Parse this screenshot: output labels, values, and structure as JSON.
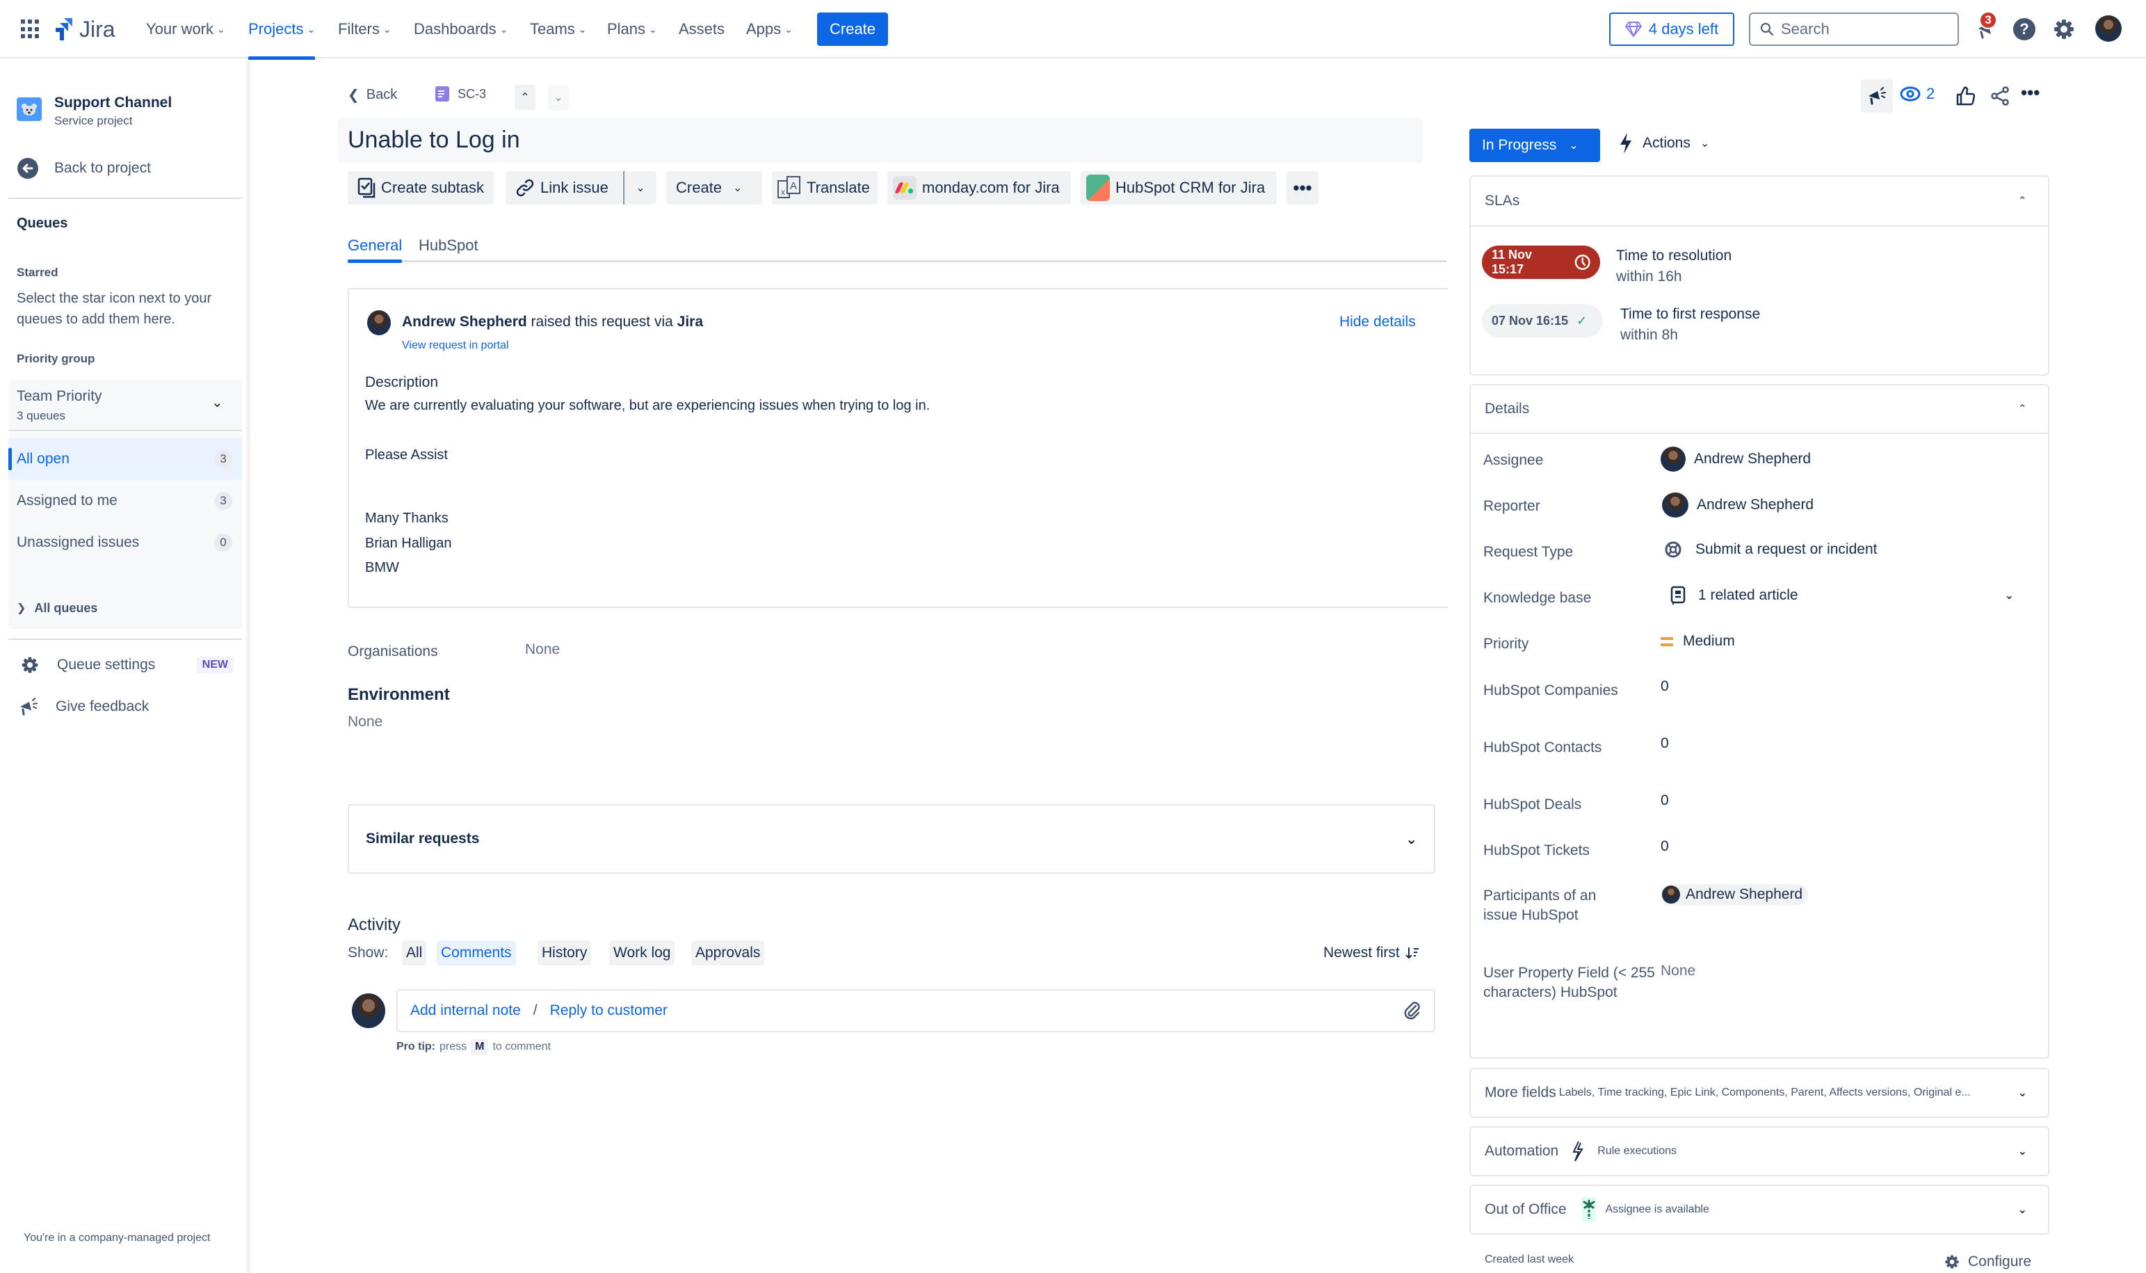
{
  "topnav": {
    "product": "Jira",
    "items": [
      {
        "label": "Your work",
        "has_menu": true
      },
      {
        "label": "Projects",
        "has_menu": true,
        "active": true
      },
      {
        "label": "Filters",
        "has_menu": true
      },
      {
        "label": "Dashboards",
        "has_menu": true
      },
      {
        "label": "Teams",
        "has_menu": true
      },
      {
        "label": "Plans",
        "has_menu": true
      },
      {
        "label": "Assets",
        "has_menu": false
      },
      {
        "label": "Apps",
        "has_menu": true
      }
    ],
    "create_label": "Create",
    "trial_label": "4 days left",
    "search_placeholder": "Search",
    "notification_count": "3",
    "icons": [
      "app-switcher-icon",
      "notifications-icon",
      "help-icon",
      "settings-icon",
      "profile-avatar"
    ]
  },
  "sidebar": {
    "project_name": "Support Channel",
    "project_type": "Service project",
    "back_label": "Back to project",
    "queues_heading": "Queues",
    "starred_heading": "Starred",
    "starred_hint": "Select the star icon next to your queues to add them here.",
    "priority_group_heading": "Priority group",
    "group_name": "Team Priority",
    "group_count": "3 queues",
    "queues": [
      {
        "label": "All open",
        "count": "3",
        "active": true
      },
      {
        "label": "Assigned to me",
        "count": "3"
      },
      {
        "label": "Unassigned issues",
        "count": "0"
      }
    ],
    "all_queues_label": "All queues",
    "queue_settings_label": "Queue settings",
    "new_badge": "NEW",
    "feedback_label": "Give feedback",
    "footer": "You're in a company-managed project"
  },
  "issue": {
    "back_label": "Back",
    "key": "SC-3",
    "title": "Unable to Log in",
    "toolbar": {
      "create_subtask": "Create subtask",
      "link_issue": "Link issue",
      "create": "Create",
      "translate": "Translate",
      "monday": "monday.com for Jira",
      "hubspot": "HubSpot CRM for Jira"
    },
    "tabs": [
      {
        "label": "General",
        "active": true
      },
      {
        "label": "HubSpot"
      }
    ],
    "request": {
      "reporter": "Andrew Shepherd",
      "raised_text": "raised this request via",
      "channel": "Jira",
      "view_portal": "View request in portal",
      "hide_details": "Hide details",
      "description_label": "Description",
      "description_lines": [
        "We are currently evaluating your software, but are experiencing issues when trying to log in.",
        "Please Assist",
        "Many Thanks",
        "Brian Halligan",
        "BMW"
      ]
    },
    "organisations_label": "Organisations",
    "organisations_value": "None",
    "environment_label": "Environment",
    "environment_value": "None",
    "similar_requests": "Similar requests",
    "activity": {
      "heading": "Activity",
      "show_label": "Show:",
      "filters": [
        {
          "label": "All"
        },
        {
          "label": "Comments",
          "active": true
        },
        {
          "label": "History"
        },
        {
          "label": "Work log"
        },
        {
          "label": "Approvals"
        }
      ],
      "sort_label": "Newest first",
      "add_note": "Add internal note",
      "separator": "/",
      "reply": "Reply to customer",
      "pro_tip_bold": "Pro tip:",
      "pro_tip_press": "press",
      "pro_tip_key": "M",
      "pro_tip_after": "to comment"
    }
  },
  "right": {
    "watchers_count": "2",
    "status": "In Progress",
    "actions": "Actions",
    "slas_heading": "SLAs",
    "slas": [
      {
        "time": "11 Nov 15:17",
        "name": "Time to resolution",
        "goal": "within 16h",
        "state": "breached"
      },
      {
        "time": "07 Nov 16:15",
        "name": "Time to first response",
        "goal": "within 8h",
        "state": "met"
      }
    ],
    "details_heading": "Details",
    "details": {
      "assignee_label": "Assignee",
      "assignee": "Andrew Shepherd",
      "reporter_label": "Reporter",
      "reporter": "Andrew Shepherd",
      "request_type_label": "Request Type",
      "request_type": "Submit a request or incident",
      "kb_label": "Knowledge base",
      "kb": "1 related article",
      "priority_label": "Priority",
      "priority": "Medium",
      "hs_companies_label": "HubSpot Companies",
      "hs_companies": "0",
      "hs_contacts_label": "HubSpot Contacts",
      "hs_contacts": "0",
      "hs_deals_label": "HubSpot Deals",
      "hs_deals": "0",
      "hs_tickets_label": "HubSpot Tickets",
      "hs_tickets": "0",
      "participants_label": "Participants of an issue HubSpot",
      "participants": "Andrew Shepherd",
      "user_prop_label": "User Property Field (< 255 characters) HubSpot",
      "user_prop": "None"
    },
    "more_fields_label": "More fields",
    "more_fields_list": "Labels, Time tracking, Epic Link, Components, Parent, Affects versions, Original e...",
    "automation_label": "Automation",
    "automation_sub": "Rule executions",
    "ooo_label": "Out of Office",
    "ooo_sub": "Assignee is available",
    "created": "Created last week",
    "configure": "Configure"
  },
  "colors": {
    "brand": "#0c66e4",
    "sla_breached": "#ae2e24",
    "sla_met_check": "#22a06b",
    "priority_medium": "#e2a03f"
  }
}
